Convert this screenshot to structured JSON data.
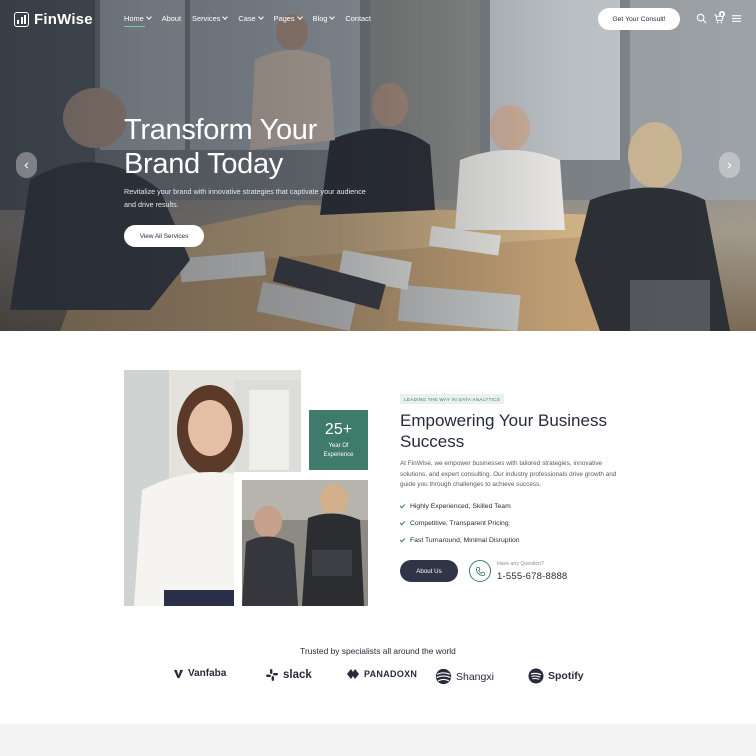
{
  "header": {
    "logo_text": "FinWise",
    "menu": [
      {
        "label": "Home",
        "dropdown": true,
        "active": true
      },
      {
        "label": "About",
        "dropdown": false,
        "active": false
      },
      {
        "label": "Services",
        "dropdown": true,
        "active": false
      },
      {
        "label": "Case",
        "dropdown": true,
        "active": false
      },
      {
        "label": "Pages",
        "dropdown": true,
        "active": false
      },
      {
        "label": "Blog",
        "dropdown": true,
        "active": false
      },
      {
        "label": "Contact",
        "dropdown": false,
        "active": false
      }
    ],
    "cta_label": "Get Your Consult!",
    "cart_count": "0",
    "icons": [
      "search-icon",
      "cart-icon",
      "menu-icon"
    ]
  },
  "hero": {
    "title_line1": "Transform Your",
    "title_line2": "Brand Today",
    "subtitle_line1": "Revitalize your brand with innovative strategies that captivate your audience",
    "subtitle_line2": "and drive results.",
    "button_label": "View All Services"
  },
  "about": {
    "experience_number": "25+",
    "experience_line1": "Year Of",
    "experience_line2": "Experience",
    "tag": "LEADING THE WAY IN DATA ANALYTICS",
    "title_line1": "Empowering Your Business",
    "title_line2": "Success",
    "description": "At FinWise, we empower businesses with tailored strategies, innovative solutions, and expert consulting. Our industry professionals drive growth and guide you through challenges to achieve success.",
    "features": [
      "Highly Experienced, Skilled Team",
      "Competitive, Transparent Pricing",
      "Fast Turnaround, Minimal Disruption"
    ],
    "button_label": "About Us",
    "phone_label": "Have any Question?",
    "phone_number": "1-555-678-8888"
  },
  "trusted": {
    "heading": "Trusted by specialists all around the world",
    "brands": [
      "Vanfaba",
      "slack",
      "PANADOXN",
      "Shangxi",
      "Spotify"
    ]
  },
  "colors": {
    "accent": "#3e7b6b",
    "dark": "#2f3447",
    "text": "#262b3b"
  }
}
